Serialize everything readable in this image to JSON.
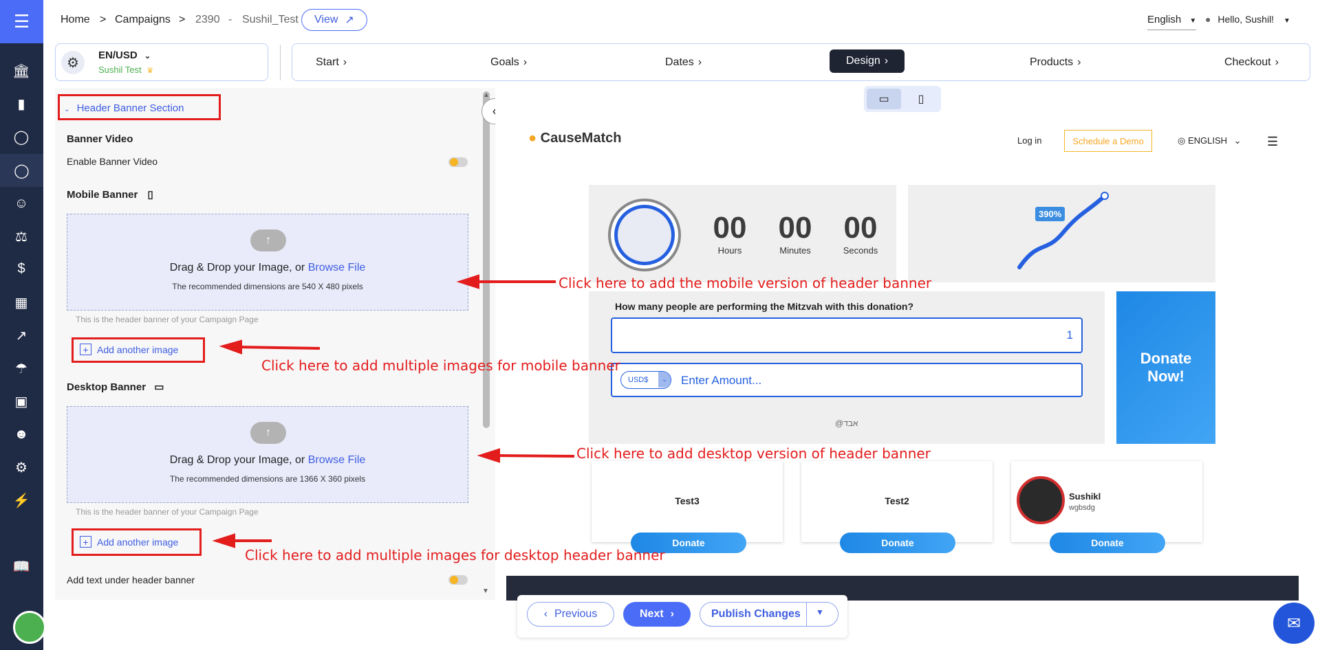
{
  "header": {
    "breadcrumb": [
      "Home",
      "Campaigns",
      "2390",
      "Sushil_Test"
    ],
    "breadcrumb_sep": ">",
    "crumb_dash": "-",
    "view_label": "View",
    "language": "English",
    "greeting": "Hello, Sushil!"
  },
  "locale": {
    "code": "EN/USD",
    "campaign_name": "Sushil Test"
  },
  "steps": [
    {
      "label": "Start"
    },
    {
      "label": "Goals"
    },
    {
      "label": "Dates"
    },
    {
      "label": "Design"
    },
    {
      "label": "Products"
    },
    {
      "label": "Checkout"
    }
  ],
  "panel": {
    "section_title": "Header Banner Section",
    "banner_video": "Banner Video",
    "enable_banner_video": "Enable Banner Video",
    "mobile_banner": "Mobile Banner",
    "desktop_banner": "Desktop Banner",
    "drag_drop": "Drag & Drop your Image, or",
    "browse_file": "Browse File",
    "mobile_dims": "The recommended dimensions are 540 X 480 pixels",
    "desktop_dims": "The recommended dimensions are 1366 X 360 pixels",
    "hint": "This is the header banner of your Campaign Page",
    "add_another": "Add another image",
    "add_text_under": "Add text under header banner"
  },
  "annotations": {
    "mobile_version": "Click here to add the mobile version of header banner",
    "mobile_multiple": "Click here to add multiple images for mobile banner",
    "desktop_version": "Click here to add desktop version of header banner",
    "desktop_multiple": "Click here to add multiple images for desktop header banner"
  },
  "preview": {
    "brand": "CauseMatch",
    "login": "Log in",
    "schedule_demo": "Schedule a Demo",
    "language": "ENGLISH",
    "countdown": [
      {
        "value": "00",
        "label": "Hours"
      },
      {
        "value": "00",
        "label": "Minutes"
      },
      {
        "value": "00",
        "label": "Seconds"
      }
    ],
    "progress_badge": "390%",
    "question": "How many people are performing the Mitzvah with this donation?",
    "people_value": "1",
    "currency": "USD$",
    "amount_placeholder": "Enter Amount...",
    "hebrew_text": "@אבד",
    "donate_now": "Donate Now!",
    "cards": [
      {
        "name": "Test3",
        "sub": "",
        "button": "Donate"
      },
      {
        "name": "Test2",
        "sub": "",
        "button": "Donate"
      },
      {
        "name": "Sushikl",
        "sub": "wgbsdg",
        "button": "Donate"
      }
    ]
  },
  "footer": {
    "previous": "Previous",
    "next": "Next",
    "publish": "Publish Changes"
  },
  "colors": {
    "accent": "#4a6cf7",
    "sidebar": "#1f2a44",
    "annotation": "#e31c1c",
    "toggle": "#f5b524"
  }
}
